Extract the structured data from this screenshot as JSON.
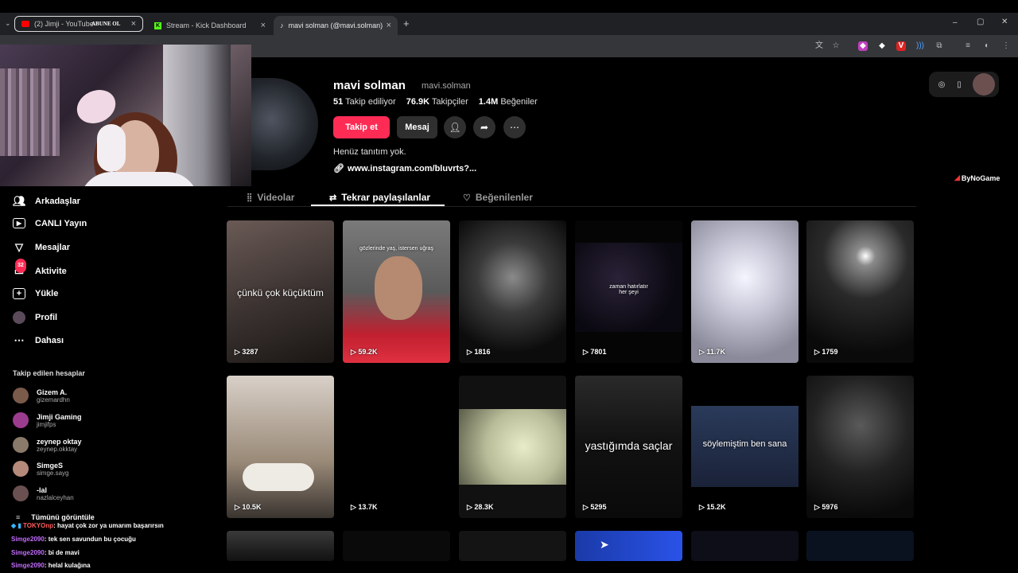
{
  "browser": {
    "tabs": [
      {
        "label": "(2) Jimji - YouTube",
        "overlay": "ABUNE OL",
        "active": false
      },
      {
        "label": "Stream - Kick Dashboard",
        "active": false
      },
      {
        "label": "mavi solman (@mavi.solman) | T",
        "active": true
      }
    ],
    "new_tab": "+",
    "window_controls": {
      "minimize": "–",
      "maximize": "▢",
      "close": "✕"
    },
    "accent": "#fe2c55"
  },
  "sidebar": {
    "items": [
      {
        "icon": "friends-icon",
        "label": "Arkadaşlar"
      },
      {
        "icon": "live-icon",
        "label": "CANLI Yayın"
      },
      {
        "icon": "messages-icon",
        "label": "Mesajlar"
      },
      {
        "icon": "activity-icon",
        "label": "Aktivite",
        "badge": "32"
      },
      {
        "icon": "upload-icon",
        "label": "Yükle"
      },
      {
        "icon": "profile-icon",
        "label": "Profil"
      },
      {
        "icon": "more-icon",
        "label": "Dahası"
      }
    ],
    "following_title": "Takip edilen hesaplar",
    "following": [
      {
        "name": "Gizem A.",
        "handle": "gizemardhn",
        "color": "#7a5a4a"
      },
      {
        "name": "Jimji Gaming",
        "handle": "jimjifps",
        "color": "#9c3c8f"
      },
      {
        "name": "zeynep oktay",
        "handle": "zeynep.okktay",
        "color": "#8a7a6a"
      },
      {
        "name": "SimgeS",
        "handle": "simge.sayg",
        "color": "#b58a7a"
      },
      {
        "name": "-lal",
        "handle": "nazlalceyhan",
        "color": "#6a5050"
      }
    ],
    "see_all": "Tümünü görüntüle"
  },
  "chat": [
    {
      "user": "TOKYOnp",
      "text": ": hayat çok zor ya umarım başarırsın"
    },
    {
      "user": "Simge2090",
      "text": ": tek sen savundun bu çocuğu"
    },
    {
      "user": "Simge2090",
      "text": ": bi de mavi"
    },
    {
      "user": "Simge2090",
      "text": ": helal kulağına"
    }
  ],
  "profile": {
    "display_name": "mavi solman",
    "username": "mavi.solman",
    "following_count": "51",
    "following_label": "Takip ediliyor",
    "followers_count": "76.9K",
    "followers_label": "Takipçiler",
    "likes_count": "1.4M",
    "likes_label": "Beğeniler",
    "follow_button": "Takip et",
    "message_button": "Mesaj",
    "bio": "Henüz tanıtım yok.",
    "link": "www.instagram.com/bluvrts?..."
  },
  "watermark": "ByNoGame",
  "content_tabs": [
    {
      "label": "Videolar",
      "icon": "grid-icon",
      "active": false
    },
    {
      "label": "Tekrar paylaşılanlar",
      "icon": "repost-icon",
      "active": true
    },
    {
      "label": "Beğenilenler",
      "icon": "heart-icon",
      "active": false
    }
  ],
  "videos": [
    {
      "views": "3287",
      "caption": "çünkü çok küçüktüm"
    },
    {
      "views": "59.2K",
      "caption": "gözlerinde yaş, istersen uğraş"
    },
    {
      "views": "1816",
      "caption": ""
    },
    {
      "views": "7801",
      "caption": "zaman hatırlatır her şeyi"
    },
    {
      "views": "11.7K",
      "caption": ""
    },
    {
      "views": "1759",
      "caption": ""
    },
    {
      "views": "10.5K",
      "caption": ""
    },
    {
      "views": "13.7K",
      "caption": ""
    },
    {
      "views": "28.3K",
      "caption": ""
    },
    {
      "views": "5295",
      "caption": "yastığımda saçlar"
    },
    {
      "views": "15.2K",
      "caption": "söylemiştim ben sana"
    },
    {
      "views": "5976",
      "caption": ""
    }
  ]
}
